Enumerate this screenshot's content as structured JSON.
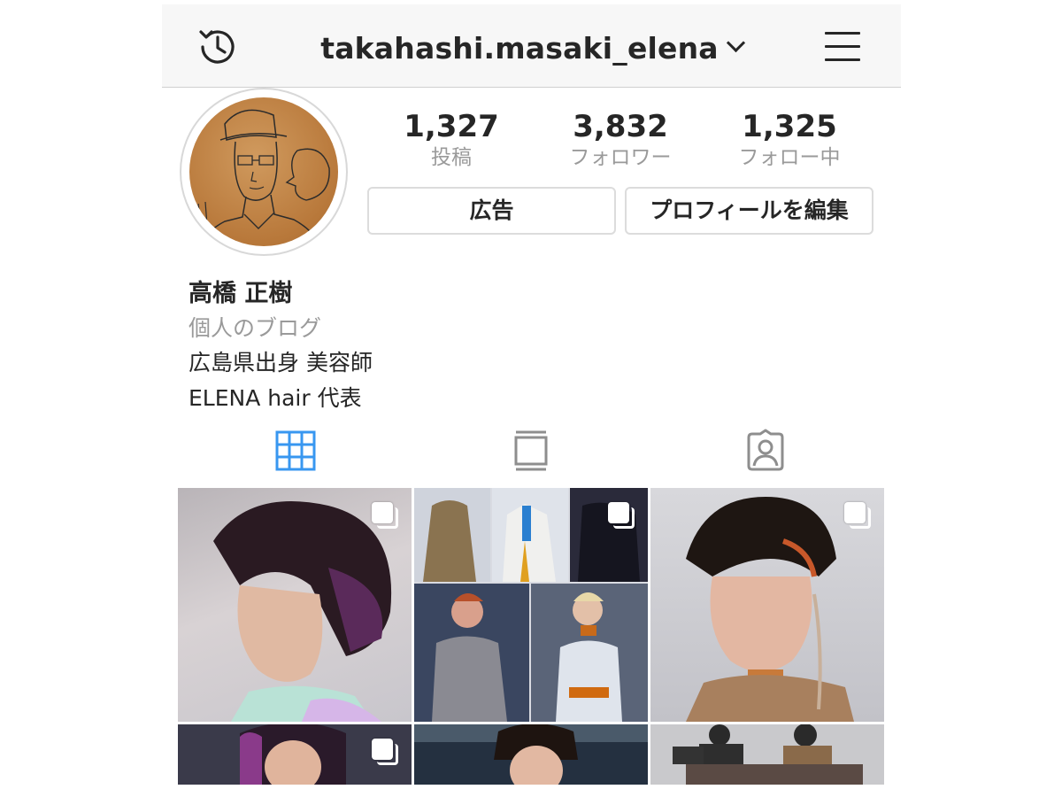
{
  "header": {
    "username": "takahashi.masaki_elena",
    "history_icon": "history-icon",
    "chevron_icon": "chevron-down-icon",
    "menu_icon": "hamburger-menu-icon"
  },
  "stats": [
    {
      "value": "1,327",
      "label": "投稿"
    },
    {
      "value": "3,832",
      "label": "フォロワー"
    },
    {
      "value": "1,325",
      "label": "フォロー中"
    }
  ],
  "buttons": {
    "promote": "広告",
    "edit_profile": "プロフィールを編集"
  },
  "bio": {
    "name": "高橋 正樹",
    "category": "個人のブログ",
    "line1": "広島県出身 美容師",
    "line2": "ELENA hair 代表"
  },
  "tabs": [
    {
      "icon": "grid-icon",
      "active": true
    },
    {
      "icon": "feed-list-icon",
      "active": false
    },
    {
      "icon": "tagged-person-icon",
      "active": false
    }
  ],
  "colors": {
    "accent_blue": "#3897f0",
    "text": "#262626",
    "muted": "#9a9a9a"
  },
  "posts": [
    {
      "icon": "multiple-photos-icon"
    },
    {
      "icon": "multiple-photos-icon"
    },
    {
      "icon": "multiple-photos-icon"
    },
    {
      "icon": "multiple-photos-icon"
    },
    {
      "icon": ""
    },
    {
      "icon": ""
    }
  ]
}
